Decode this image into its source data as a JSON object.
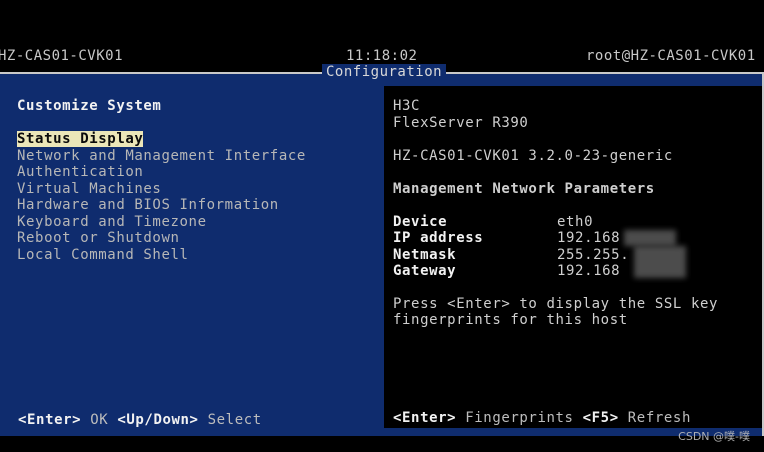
{
  "topbar": {
    "host_left": "HZ-CAS01-CVK01",
    "clock": "11:18:02",
    "host_right": "root@HZ-CAS01-CVK01"
  },
  "dialog": {
    "title": "Configuration"
  },
  "left": {
    "heading": "Customize System",
    "menu": [
      "Status Display",
      "Network and Management Interface",
      "Authentication",
      "Virtual Machines",
      "Hardware and BIOS Information",
      "Keyboard and Timezone",
      "Reboot or Shutdown",
      "Local Command Shell"
    ],
    "selected_index": 0,
    "footer": {
      "key1": "<Enter>",
      "label1": "OK",
      "key2": "<Up/Down>",
      "label2": "Select"
    }
  },
  "right": {
    "vendor": "H3C",
    "model": "FlexServer R390",
    "version": "HZ-CAS01-CVK01 3.2.0-23-generic",
    "section_title": "Management Network Parameters",
    "params": {
      "device_label": "Device",
      "device_value": "eth0",
      "ip_label": "IP address",
      "ip_value": "192.168",
      "netmask_label": "Netmask",
      "netmask_value": "255.255.",
      "gateway_label": "Gateway",
      "gateway_value": "192.168"
    },
    "hint_line1": "Press <Enter> to display the SSL key",
    "hint_line2": "fingerprints for this host",
    "footer": {
      "key1": "<Enter>",
      "label1": "Fingerprints",
      "key2": "<F5>",
      "label2": "Refresh"
    }
  },
  "watermark": "CSDN @噗-噗",
  "colors": {
    "panel_blue": "#0f2c6e",
    "highlight": "#ebe6b8",
    "background": "#000000"
  }
}
